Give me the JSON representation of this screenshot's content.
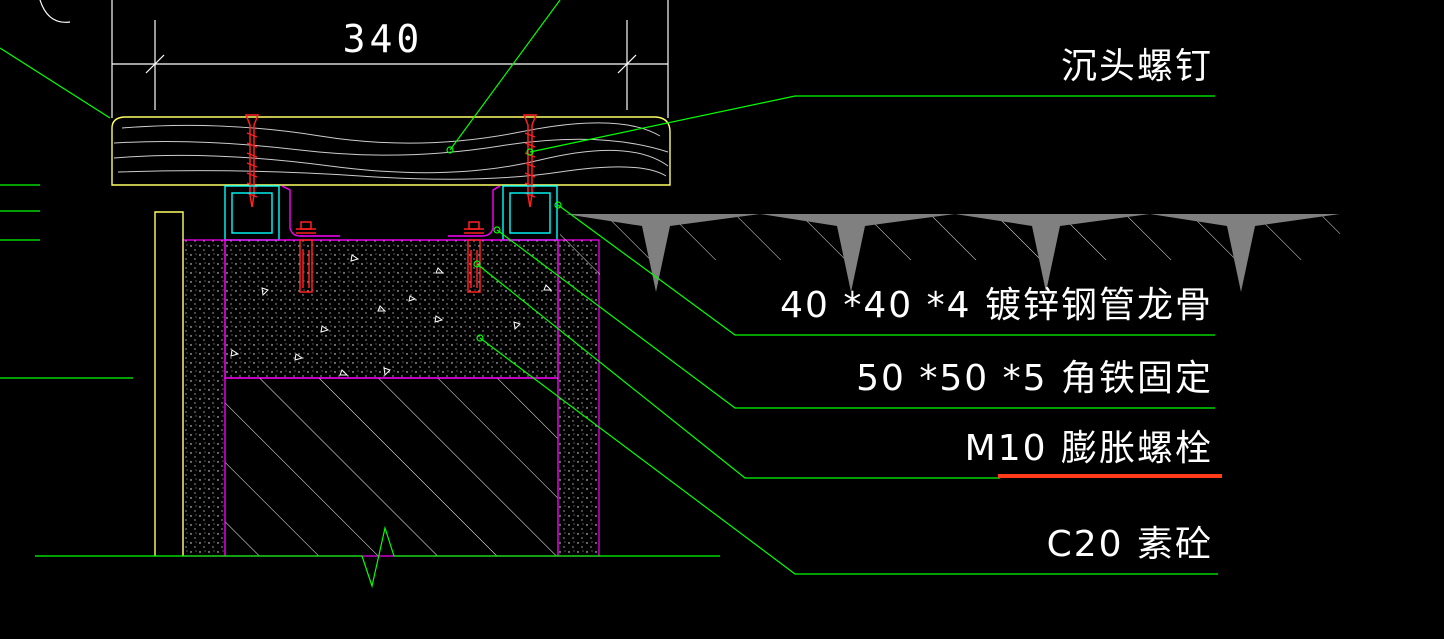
{
  "drawing": {
    "dimension_text": "340",
    "labels": {
      "screw": "沉头螺钉",
      "keel": "40 *40 *4 镀锌钢管龙骨",
      "angle": "50 *50 *5 角铁固定",
      "bolt": "M10 膨胀螺栓",
      "concrete": "C20 素砼"
    }
  },
  "colors": {
    "background": "#000000",
    "leader": "#00ff00",
    "dimension": "#ffffff",
    "wood_outline": "#ffff66",
    "tube": "#00ffff",
    "magenta": "#ff00ff",
    "bolt": "#ff2020",
    "highlight": "#ff3b1a",
    "grating": "#808080"
  }
}
